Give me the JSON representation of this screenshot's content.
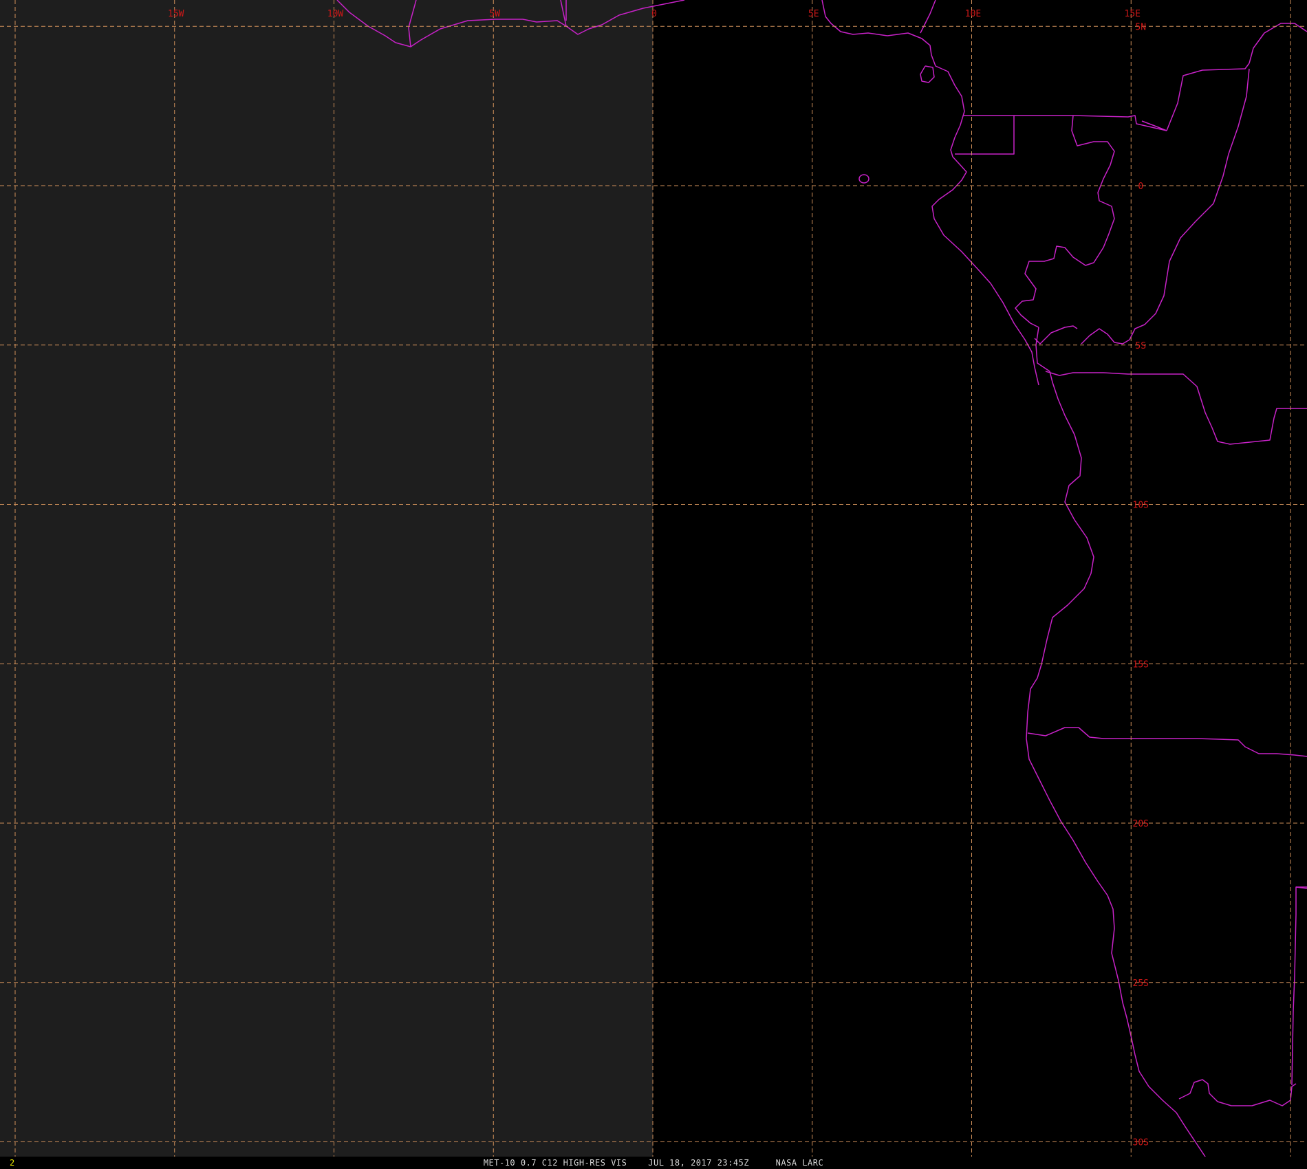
{
  "image": {
    "colors": {
      "background": "#000000",
      "no_data_region": "#1e1e1e",
      "grid_line": "#d0905a",
      "grid_label": "#d01818",
      "boundary_line": "#c822c8",
      "frame_number": "#e8e800",
      "caption": "#d8d8d8"
    }
  },
  "map": {
    "longitude_labels": [
      "15W",
      "10W",
      "5W",
      "0",
      "5E",
      "10E",
      "15E"
    ],
    "latitude_labels": [
      "5N",
      "0",
      "5S",
      "10S",
      "15S",
      "20S",
      "25S",
      "30S"
    ],
    "lon_lines_deg": [
      -20,
      -15,
      -10,
      -5,
      0,
      5,
      10,
      15,
      20
    ],
    "lat_lines_deg": [
      5,
      0,
      -5,
      -10,
      -15,
      -20,
      -25,
      -30
    ]
  },
  "status_bar": {
    "frame_number": "2",
    "caption": "MET-10 0.7 C12 HIGH-RES VIS    JUL 18, 2017 23:45Z     NASA LARC"
  }
}
